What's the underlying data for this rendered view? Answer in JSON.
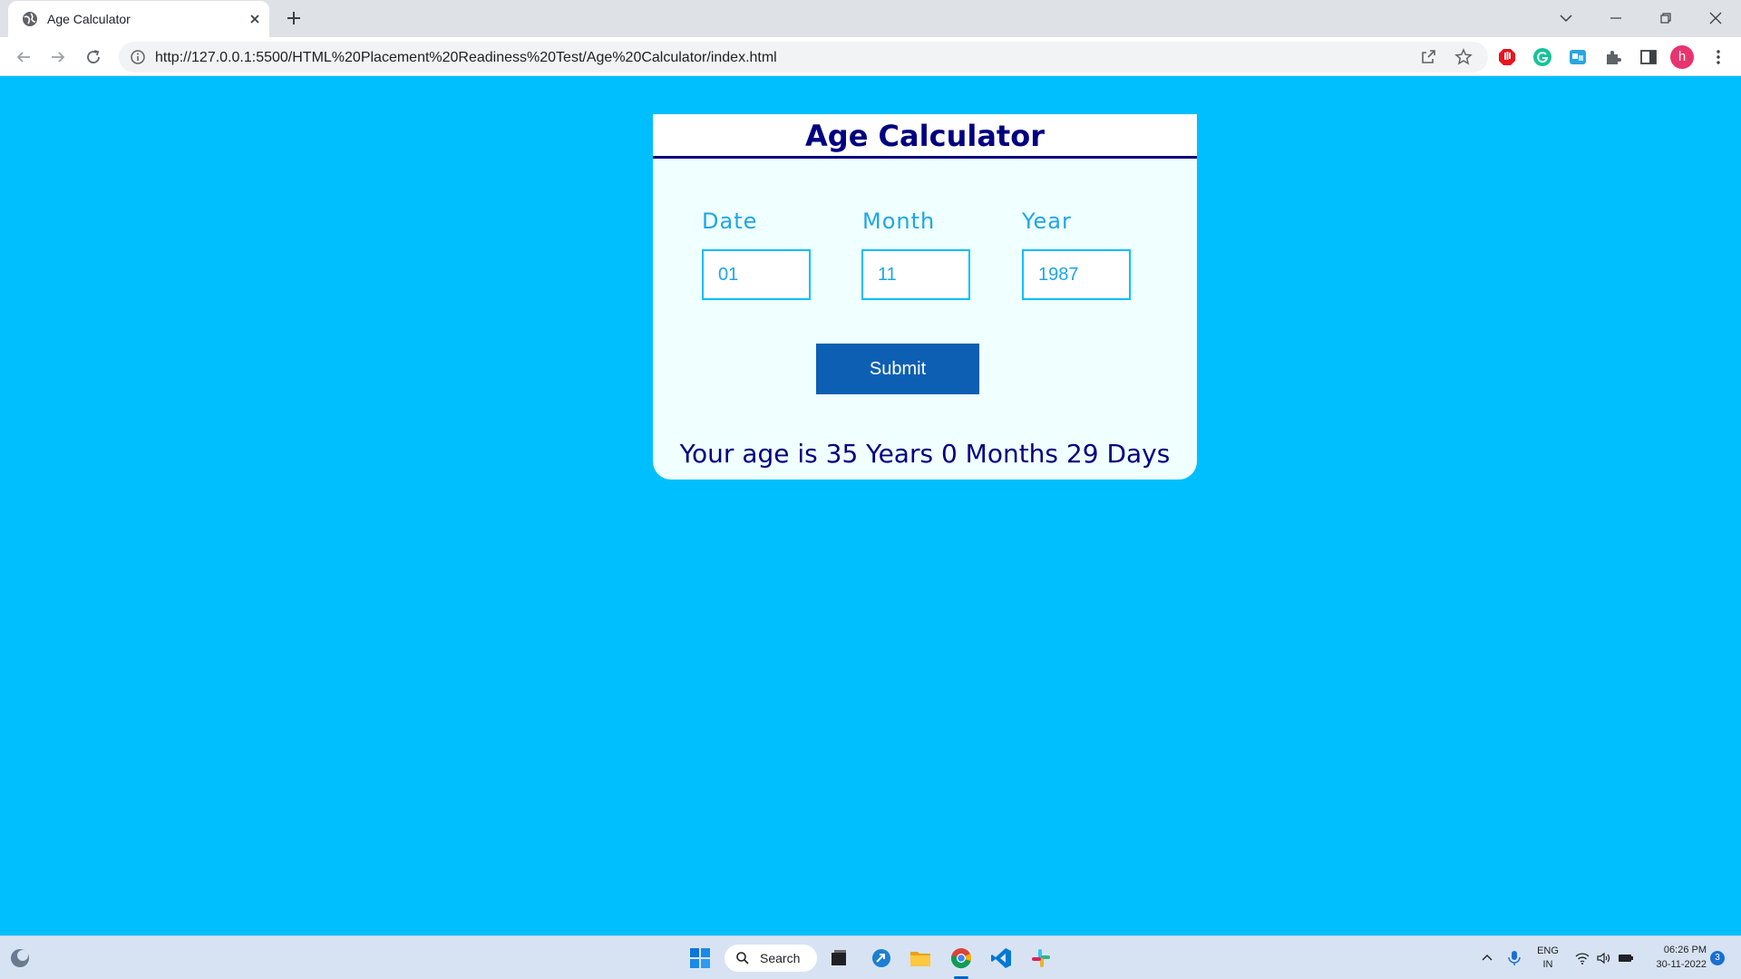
{
  "browser": {
    "tab_title": "Age Calculator",
    "url": "http://127.0.0.1:5500/HTML%20Placement%20Readiness%20Test/Age%20Calculator/index.html",
    "profile_initial": "h"
  },
  "page": {
    "title": "Age Calculator",
    "fields": [
      {
        "label": "Date",
        "value": "01"
      },
      {
        "label": "Month",
        "value": "11"
      },
      {
        "label": "Year",
        "value": "1987"
      }
    ],
    "submit_label": "Submit",
    "result_text": "Your age is 35 Years 0 Months 29 Days"
  },
  "taskbar": {
    "search_label": "Search",
    "language": "ENG",
    "region": "IN",
    "time": "06:26 PM",
    "date": "30-11-2022",
    "notification_count": "3"
  },
  "colors": {
    "page_background": "#00bfff",
    "card_background": "#f0ffff",
    "title_color": "#000080",
    "label_color": "#1ea6e6",
    "submit_background": "#0d5fb4"
  }
}
